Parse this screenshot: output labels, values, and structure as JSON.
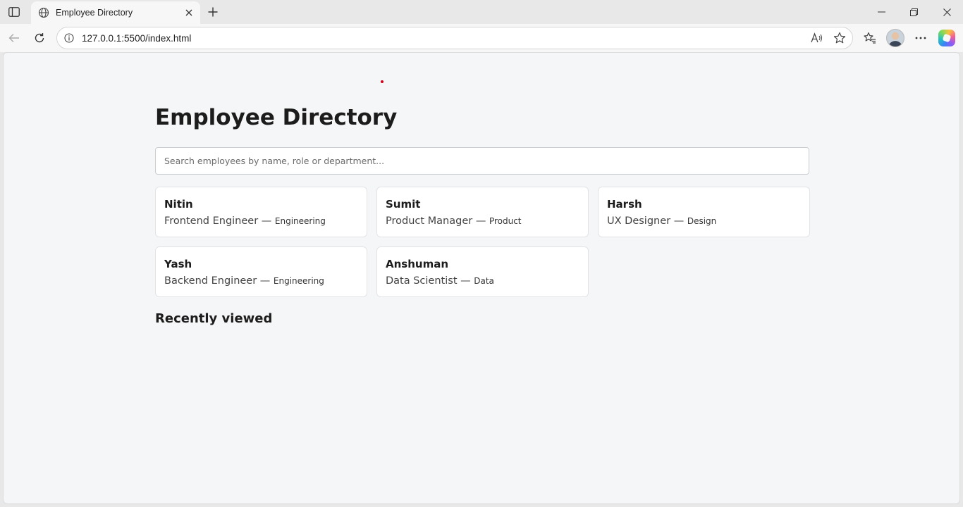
{
  "browser": {
    "tab": {
      "title": "Employee Directory"
    },
    "address_bar": {
      "url": "127.0.0.1:5500/index.html"
    }
  },
  "page": {
    "title": "Employee Directory",
    "search": {
      "placeholder": "Search employees by name, role or department...",
      "value": ""
    },
    "employees": [
      {
        "name": "Nitin",
        "role": "Frontend Engineer",
        "separator": "—",
        "department": "Engineering"
      },
      {
        "name": "Sumit",
        "role": "Product Manager",
        "separator": "—",
        "department": "Product"
      },
      {
        "name": "Harsh",
        "role": "UX Designer",
        "separator": "—",
        "department": "Design"
      },
      {
        "name": "Yash",
        "role": "Backend Engineer",
        "separator": "—",
        "department": "Engineering"
      },
      {
        "name": "Anshuman",
        "role": "Data Scientist",
        "separator": "—",
        "department": "Data"
      }
    ],
    "recently_viewed": {
      "heading": "Recently viewed"
    }
  },
  "icons": [
    "sidebar-icon",
    "globe-icon",
    "close-icon",
    "plus-icon",
    "minimize-icon",
    "restore-icon",
    "window-close-icon",
    "back-icon",
    "refresh-icon",
    "info-icon",
    "read-aloud-icon",
    "star-icon",
    "favorites-icon",
    "more-icon",
    "copilot-icon"
  ],
  "colors": {
    "accent_dot": "#d0021b",
    "page_background": "#f5f6f8",
    "card_background": "#ffffff"
  }
}
